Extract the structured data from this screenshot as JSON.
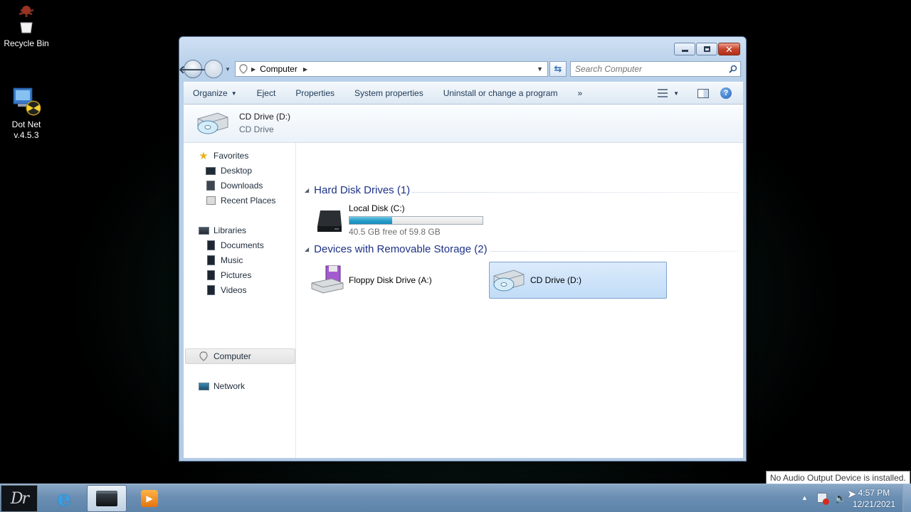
{
  "desktop": {
    "icons": [
      {
        "label": "Recycle Bin",
        "icon": "recycle-bin-icon"
      },
      {
        "label_line1": "Dot Net",
        "label_line2": "v.4.5.3",
        "icon": "dotnet-installer-icon"
      }
    ]
  },
  "window": {
    "caption_buttons": [
      "minimize",
      "maximize",
      "close"
    ],
    "address": {
      "crumbs": [
        "Computer"
      ]
    },
    "search": {
      "placeholder": "Search Computer"
    },
    "toolbar": {
      "organize": "Organize",
      "eject": "Eject",
      "properties": "Properties",
      "system_properties": "System properties",
      "uninstall": "Uninstall or change a program",
      "more": "»"
    },
    "details": {
      "title": "CD Drive (D:)",
      "subtitle": "CD Drive"
    },
    "nav": {
      "favorites": "Favorites",
      "desktop": "Desktop",
      "downloads": "Downloads",
      "recent": "Recent Places",
      "libraries": "Libraries",
      "documents": "Documents",
      "music": "Music",
      "pictures": "Pictures",
      "videos": "Videos",
      "computer": "Computer",
      "network": "Network"
    },
    "groups": {
      "hdd": {
        "title": "Hard Disk Drives (1)",
        "drive": {
          "name": "Local Disk (C:)",
          "free_text": "40.5 GB free of 59.8 GB",
          "used_fraction": 0.32
        }
      },
      "removable": {
        "title": "Devices with Removable Storage (2)",
        "floppy": "Floppy Disk Drive (A:)",
        "cd": "CD Drive (D:)"
      }
    }
  },
  "taskbar": {
    "tooltip": "No Audio Output Device is installed.",
    "time": "4:57 PM",
    "date": "12/21/2021"
  },
  "colors": {
    "accent": "#1e3287",
    "selection": "#c1dcf7",
    "bar": "#2a9fc9"
  }
}
